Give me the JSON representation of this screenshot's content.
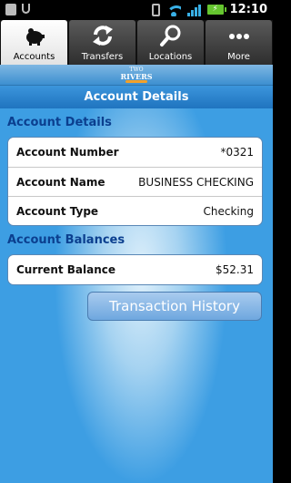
{
  "status_bar": {
    "time": "12:10",
    "icons": [
      "notification-icon",
      "usb-icon",
      "vibrate-icon",
      "wifi-icon",
      "signal-icon",
      "battery-charging-icon"
    ]
  },
  "tabs": [
    {
      "label": "Accounts",
      "icon": "piggy-bank-icon",
      "active": true
    },
    {
      "label": "Transfers",
      "icon": "transfer-arrows-icon",
      "active": false
    },
    {
      "label": "Locations",
      "icon": "search-icon",
      "active": false
    },
    {
      "label": "More",
      "icon": "more-dots-icon",
      "active": false
    }
  ],
  "logo": {
    "line1": "TWO",
    "line2": "RIVERS"
  },
  "page_title": "Account Details",
  "account_details": {
    "heading": "Account Details",
    "rows": [
      {
        "label": "Account Number",
        "value": "*0321"
      },
      {
        "label": "Account Name",
        "value": "BUSINESS CHECKING"
      },
      {
        "label": "Account Type",
        "value": "Checking"
      }
    ]
  },
  "account_balances": {
    "heading": "Account Balances",
    "rows": [
      {
        "label": "Current Balance",
        "value": "$52.31"
      }
    ]
  },
  "actions": {
    "transaction_history": "Transaction History"
  },
  "colors": {
    "heading": "#0b3f8f",
    "title_bar": "#1f74bf",
    "background": "#3d9ee3",
    "button": "#6ea7df"
  }
}
